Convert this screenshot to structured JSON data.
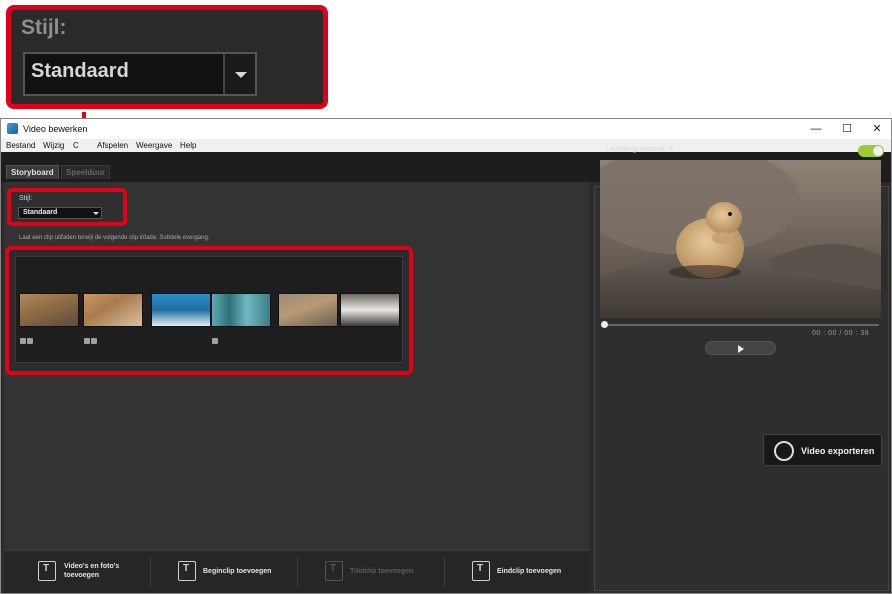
{
  "callout": {
    "style_label": "Stijl:",
    "style_value": "Standaard"
  },
  "window": {
    "title": "Video bewerken",
    "controls": {
      "minimize": "—",
      "maximize": "☐",
      "close": "✕"
    }
  },
  "menubar": {
    "items": [
      "Bestand",
      "Wijzig",
      "C",
      "Afspelen",
      "Weergave",
      "Help"
    ]
  },
  "tabs": {
    "active": "Storyboard",
    "inactive": "Speelduur"
  },
  "style": {
    "label": "Stijl:",
    "value": "Standaard"
  },
  "transition_description": "Laat een clip uitfaden terwijl de volgende clip infade. Subtiele overgang.",
  "storyboard": {
    "clips": [
      {
        "name": "prairie-dog-photo",
        "icons": [
          "film",
          "photo"
        ]
      },
      {
        "name": "lynx-photo",
        "icons": [
          "film",
          "photo"
        ]
      },
      {
        "name": "orca-photo",
        "icons": []
      },
      {
        "name": "sea-lion-photo",
        "icons": [
          "film"
        ]
      },
      {
        "name": "prairie-dog-2-photo",
        "icons": []
      },
      {
        "name": "zebra-photo",
        "icons": []
      }
    ]
  },
  "bottom_actions": {
    "add_media": "Video's en foto's toevoegen",
    "add_start": "Beginclip toevoegen",
    "add_title": "Titelclip toevoegen",
    "add_end": "Eindclip toevoegen"
  },
  "preview": {
    "music_label": "Achtergr.muziek: 0",
    "time_current": "00 : 00",
    "time_sep": "/",
    "time_total": "00 : 38",
    "export_label": "Video exporteren"
  },
  "colors": {
    "highlight": "#e0001a",
    "toggle_on": "#9acd32",
    "background": "#2b2b2b"
  }
}
